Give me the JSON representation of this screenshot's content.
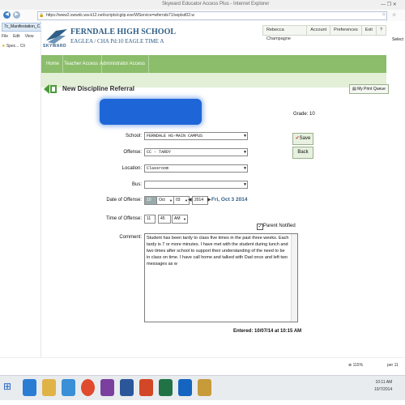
{
  "window": {
    "title": "Skyward Educator Access Plus - Internet Explorer"
  },
  "browser": {
    "url": "https://www2.swwdc.wa-k12.net/scripts/cgiip.exe/WService=wfernds71/seplsd02.w",
    "tab_label": "7c_Manifestation_C...",
    "menu": [
      "File",
      "Edit",
      "View"
    ],
    "favorites": [
      "Spec...",
      "Cli"
    ],
    "zoom": "115%",
    "side_text": "per 11"
  },
  "app": {
    "logo_text": "SKYWARD",
    "school_name": "FERNDALE HIGH SCHOOL",
    "term_line": "EAGLEA / CHA Pd:10 EAGLE TIME A",
    "user_name": "Rebecca Champagne",
    "links": [
      "Account",
      "Preferences",
      "Exit",
      "?"
    ],
    "nav": [
      "Home",
      "Teacher Access",
      "Administrator Access"
    ]
  },
  "page": {
    "title": "New Discipline Referral",
    "print_queue": "My Print Queue",
    "grade_label": "Grade:",
    "grade_value": "10"
  },
  "form": {
    "school_label": "School:",
    "school_value": "FERNDALE HS-MAIN CAMPUS",
    "offense_label": "Offense:",
    "offense_value": "CC  - TARDY",
    "location_label": "Location:",
    "location_value": "Classroom",
    "bus_label": "Bus:",
    "bus_value": "",
    "date_label": "Date of Offense:",
    "date_month": "10",
    "date_month_name": "Oct",
    "date_day": "03",
    "date_year": "2014",
    "date_display": "Fri, Oct 3 2014",
    "time_label": "Time of Offense:",
    "time_hour": "11",
    "time_minute": "45",
    "time_ampm": "AM",
    "parent_notified_label": "Parent Notified",
    "parent_notified": true,
    "comment_label": "Comment:",
    "comment_text": "Student has been tardy to class five times in the past three weeks.  Each tardy is 7 or more minutes.  I have met with the student during lunch and two times after school to support their understanding of the need to be in class on time.  I have call home and talked with Dad once and left two messages as w",
    "save_label": "Save",
    "back_label": "Back",
    "entered_label": "Entered:",
    "entered_value": "10/07/14 at 10:15 AM"
  },
  "taskbar": {
    "time": "10:11 AM",
    "date": "10/7/2014"
  },
  "colors": {
    "nav_green": "#8bbd6a",
    "title_blue": "#2f5e86",
    "redaction_blue": "#1e66d8"
  }
}
